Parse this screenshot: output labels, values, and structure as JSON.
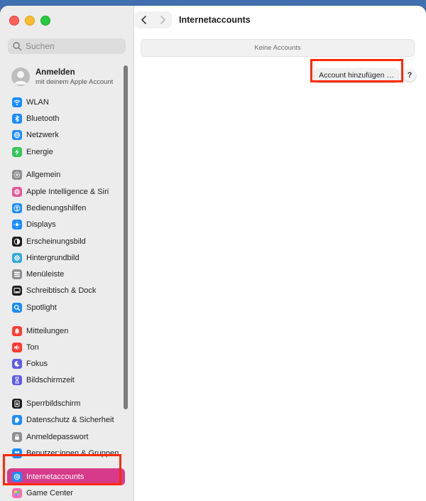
{
  "sidebar": {
    "search_placeholder": "Suchen",
    "account": {
      "title": "Anmelden",
      "subtitle": "mit deinem Apple Account"
    },
    "groups": [
      [
        {
          "label": "WLAN",
          "icon": "wifi-icon",
          "color": "#1a8cff"
        },
        {
          "label": "Bluetooth",
          "icon": "bluetooth-icon",
          "color": "#1a8cff"
        },
        {
          "label": "Netzwerk",
          "icon": "globe-icon",
          "color": "#1a8cff"
        },
        {
          "label": "Energie",
          "icon": "battery-icon",
          "color": "#34c759"
        }
      ],
      [
        {
          "label": "Allgemein",
          "icon": "gear-icon",
          "color": "#8e8e93"
        },
        {
          "label": "Apple Intelligence & Siri",
          "icon": "siri-icon",
          "color": "#e05a9b"
        },
        {
          "label": "Bedienungshilfen",
          "icon": "accessibility-icon",
          "color": "#1a8cff"
        },
        {
          "label": "Displays",
          "icon": "sun-icon",
          "color": "#1a8cff"
        },
        {
          "label": "Erscheinungsbild",
          "icon": "appearance-icon",
          "color": "#1d1d1f"
        },
        {
          "label": "Hintergrundbild",
          "icon": "wallpaper-icon",
          "color": "#34aadc"
        },
        {
          "label": "Menüleiste",
          "icon": "menubar-icon",
          "color": "#8e8e93"
        },
        {
          "label": "Schreibtisch & Dock",
          "icon": "dock-icon",
          "color": "#1d1d1f"
        },
        {
          "label": "Spotlight",
          "icon": "magnifier-icon",
          "color": "#1a8cff"
        }
      ],
      [
        {
          "label": "Mitteilungen",
          "icon": "bell-icon",
          "color": "#ff3b30"
        },
        {
          "label": "Ton",
          "icon": "speaker-icon",
          "color": "#ff3b30"
        },
        {
          "label": "Fokus",
          "icon": "moon-icon",
          "color": "#5e5ce6"
        },
        {
          "label": "Bildschirmzeit",
          "icon": "hourglass-icon",
          "color": "#5e5ce6"
        }
      ],
      [
        {
          "label": "Sperrbildschirm",
          "icon": "lock-screen-icon",
          "color": "#1d1d1f"
        },
        {
          "label": "Datenschutz & Sicherheit",
          "icon": "hand-icon",
          "color": "#1a8cff"
        },
        {
          "label": "Anmeldepasswort",
          "icon": "lock-icon",
          "color": "#8e8e93"
        },
        {
          "label": "Benutzer:innen & Gruppen",
          "icon": "users-icon",
          "color": "#1a8cff"
        }
      ],
      [
        {
          "label": "Internetaccounts",
          "icon": "at-icon",
          "color": "#1a8cff",
          "selected": true
        },
        {
          "label": "Game Center",
          "icon": "gamecenter-icon",
          "color": "#ff6ab4"
        }
      ]
    ]
  },
  "toolbar": {
    "title": "Internetaccounts"
  },
  "main": {
    "empty_text": "Keine Accounts",
    "add_button": "Account hinzufügen …",
    "help_button": "?"
  },
  "colors": {
    "selection": "#d83a8b",
    "highlight": "#ff2a00"
  }
}
